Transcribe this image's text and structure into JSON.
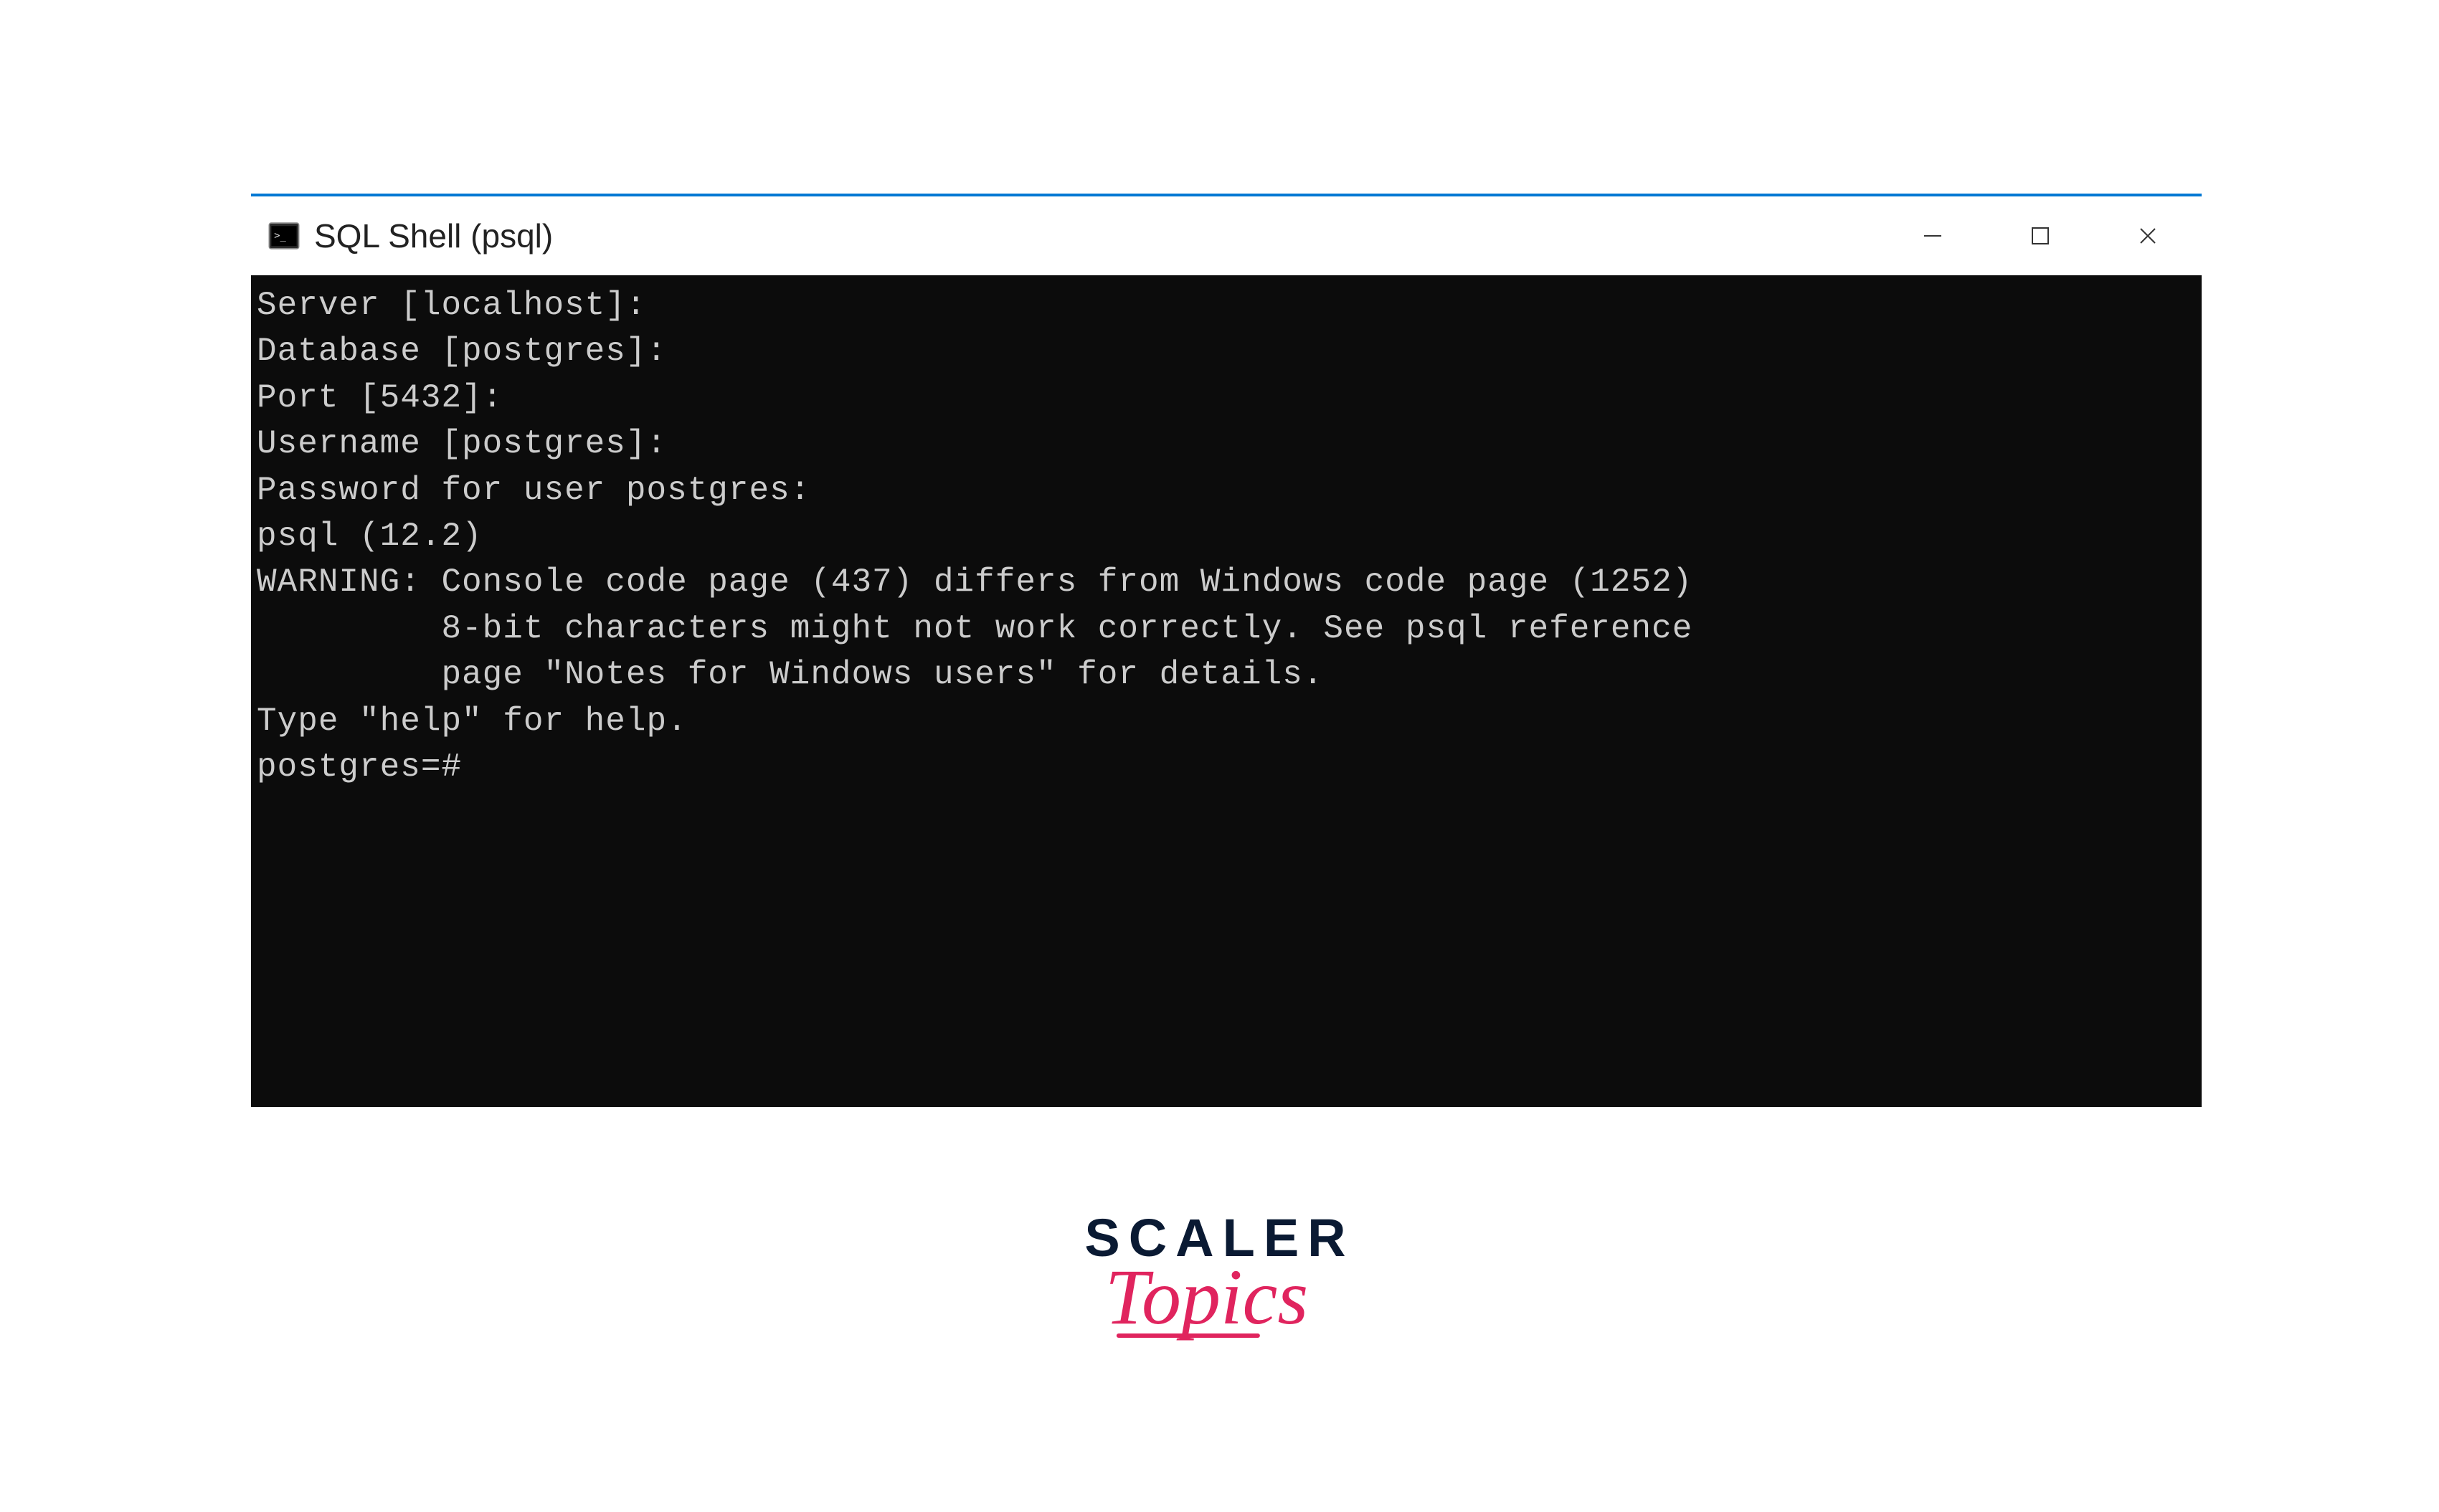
{
  "window": {
    "title": "SQL Shell (psql)",
    "icon": "console-icon"
  },
  "terminal": {
    "lines": [
      "Server [localhost]:",
      "Database [postgres]:",
      "Port [5432]:",
      "Username [postgres]:",
      "Password for user postgres:",
      "psql (12.2)",
      "WARNING: Console code page (437) differs from Windows code page (1252)",
      "         8-bit characters might not work correctly. See psql reference",
      "         page \"Notes for Windows users\" for details.",
      "Type \"help\" for help.",
      "",
      "postgres=#"
    ]
  },
  "brand": {
    "main": "SCALER",
    "script": "Topics"
  }
}
